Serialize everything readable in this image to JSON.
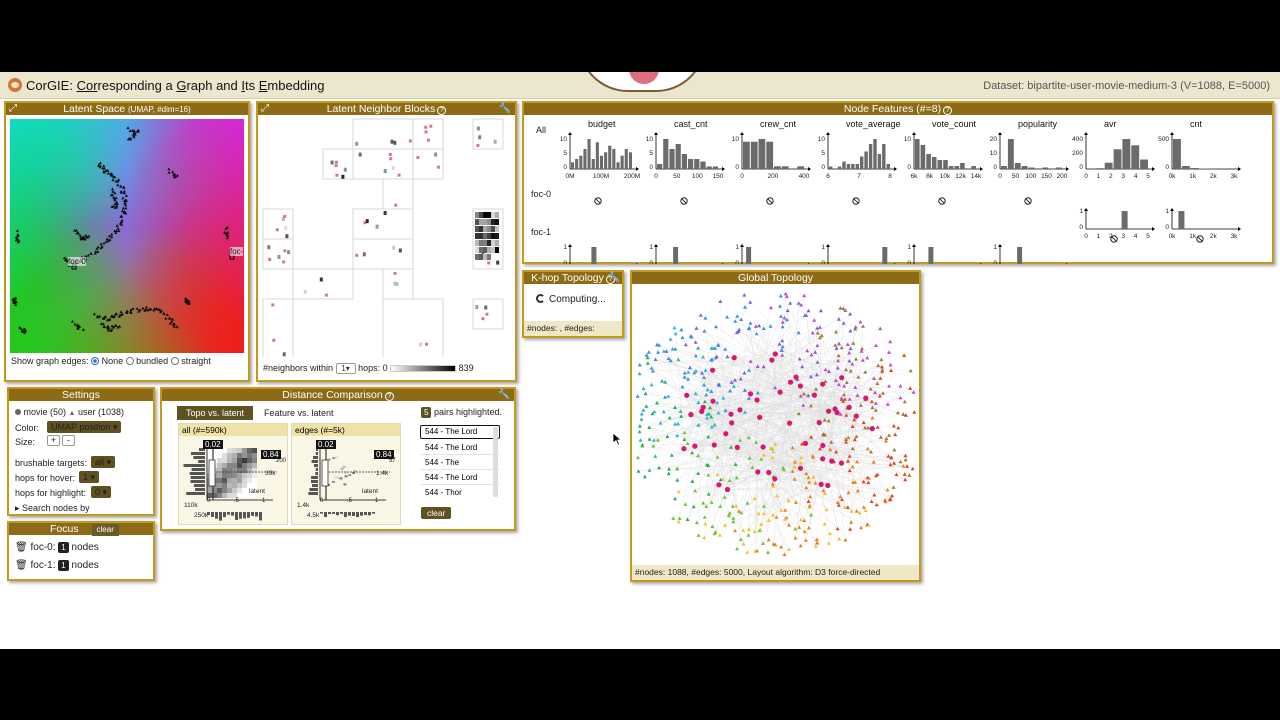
{
  "app": {
    "title_pre": "CorGIE: ",
    "title_c1": "Cor",
    "title_m1": "responding a ",
    "title_c2": "G",
    "title_m2": "raph and ",
    "title_c3": "I",
    "title_m3": "ts ",
    "title_c4": "E",
    "title_m4": "mbedding",
    "dataset": "Dataset: bipartite-user-movie-medium-3 (V=1088, E=5000)"
  },
  "latent": {
    "title": "Latent Space",
    "subtitle": "(UMAP, #dim=16)",
    "label_foc0": "foc-0",
    "label_foc1": "foc-",
    "edges_label": "Show graph edges:",
    "opt_none": "None",
    "opt_bundled": "bundled",
    "opt_straight": "straight"
  },
  "neighbors": {
    "title": "Latent Neighbor Blocks",
    "footer_pre": "#neighbors within",
    "hops_value": "1",
    "footer_hops": "hops:",
    "range_min": "0",
    "range_max": "839"
  },
  "features": {
    "title": "Node Features (#=8)",
    "row_all": "All",
    "row_foc0": "foc-0",
    "row_foc1": "foc-1",
    "columns": [
      {
        "name": "budget",
        "ticks": [
          "0M",
          "100M",
          "200M"
        ],
        "yticks": [
          "10",
          "5",
          "0"
        ]
      },
      {
        "name": "cast_cnt",
        "ticks": [
          "0",
          "50",
          "100",
          "150"
        ],
        "yticks": [
          "10",
          "5",
          "0"
        ]
      },
      {
        "name": "crew_cnt",
        "ticks": [
          "0",
          "200",
          "400"
        ],
        "yticks": [
          "10",
          "0"
        ]
      },
      {
        "name": "vote_average",
        "ticks": [
          "6",
          "7",
          "8"
        ],
        "yticks": [
          "10",
          "5",
          "0"
        ]
      },
      {
        "name": "vote_count",
        "ticks": [
          "6k",
          "8k",
          "10k",
          "12k",
          "14k"
        ],
        "yticks": [
          "10",
          "0"
        ]
      },
      {
        "name": "popularity",
        "ticks": [
          "0",
          "50",
          "100",
          "150",
          "200"
        ],
        "yticks": [
          "20",
          "10",
          "0"
        ]
      },
      {
        "name": "avr",
        "ticks": [
          "0",
          "1",
          "2",
          "3",
          "4",
          "5"
        ],
        "yticks": [
          "400",
          "200",
          "0"
        ]
      },
      {
        "name": "cnt",
        "ticks": [
          "0k",
          "1k",
          "2k",
          "3k"
        ],
        "yticks": [
          "500",
          "0"
        ]
      }
    ]
  },
  "khop": {
    "title": "K-hop Topology",
    "status": "Computing...",
    "footer": "#nodes: , #edges:"
  },
  "global": {
    "title": "Global Topology",
    "footer": "#nodes: 1088, #edges: 5000, Layout algorithm: D3 force-directed"
  },
  "settings": {
    "title": "Settings",
    "legend_movie": "movie (50)",
    "legend_user": "user (1038)",
    "color_label": "Color:",
    "color_value": "UMAP position",
    "size_label": "Size:",
    "size_plus": "+",
    "size_minus": "-",
    "brush_label": "brushable targets:",
    "brush_value": "all",
    "hover_label": "hops for hover:",
    "hover_value": "1",
    "highlight_label": "hops for highlight:",
    "highlight_value": "0",
    "search_label": "Search nodes by"
  },
  "focus": {
    "title": "Focus",
    "clear": "clear",
    "items": [
      {
        "name": "foc-0:",
        "count": "1",
        "unit": "nodes"
      },
      {
        "name": "foc-1:",
        "count": "1",
        "unit": "nodes"
      }
    ]
  },
  "distance": {
    "title": "Distance Comparison",
    "tab_active": "Topo vs. latent",
    "tab_other": "Feature vs. latent",
    "highlight_count": "5",
    "highlight_text": "pairs highlighted.",
    "chart_all": {
      "title": "all (#=590k)",
      "val_left": "0.02",
      "val_right": "0.84",
      "xlabel": "latent",
      "tick_y1": "110k",
      "tick_y2": "250k",
      "tick_r1": "39k",
      "tick_r2": "200",
      "x0": "0",
      "x1": ".5",
      "x2": "1"
    },
    "chart_edges": {
      "title": "edges (#=5k)",
      "val_left": "0.02",
      "val_right": "0.84",
      "xlabel": "latent",
      "tick_y1": "1.4k",
      "tick_y2": "4.5k",
      "tick_r1": "1.4k",
      "tick_r2": "57",
      "x0": "0",
      "x1": ".5",
      "x2": "1"
    },
    "pairs": [
      "544 - The Lord",
      "544 - The Lord",
      "544 - The",
      "544 - The Lord",
      "544 - Thor"
    ],
    "clear": "clear"
  },
  "colors": {
    "accent": "#c19a1f",
    "header": "#8c6a16",
    "footer": "#efe7c6",
    "movie_node": "#d6186e"
  },
  "hist_bars": [
    [
      2,
      3,
      4,
      6,
      9,
      3,
      8,
      4,
      5,
      7,
      6,
      2,
      4,
      6,
      5
    ],
    [
      2,
      12,
      8,
      10,
      6,
      4,
      4,
      3,
      1,
      1
    ],
    [
      10,
      10,
      11,
      10,
      1,
      1,
      0,
      1
    ],
    [
      1,
      0,
      1,
      3,
      2,
      2,
      2,
      5,
      7,
      10,
      12,
      6,
      10,
      2
    ],
    [
      10,
      8,
      5,
      4,
      3,
      3,
      1,
      1,
      2,
      0,
      1
    ],
    [
      2,
      20,
      4,
      2,
      1,
      0,
      1,
      0,
      1
    ],
    [
      1,
      10,
      80,
      250,
      380,
      300,
      120
    ],
    [
      600,
      60,
      20,
      10,
      5,
      2,
      1
    ]
  ],
  "foc0_bars": {
    "avr": [
      0,
      0,
      0,
      1,
      0,
      0
    ],
    "cnt": [
      1,
      0,
      0,
      0
    ]
  },
  "foc1_bars": {
    "budget": [
      0,
      0,
      1,
      0,
      0,
      0,
      0
    ],
    "cast_cnt": [
      0,
      1,
      0,
      0,
      0
    ],
    "crew_cnt": [
      1,
      0,
      0,
      0,
      0,
      0
    ],
    "vote_average": [
      0,
      0,
      0,
      0,
      1
    ],
    "vote_count": [
      0,
      1,
      0,
      0,
      0,
      0
    ],
    "popularity": [
      0,
      1,
      0,
      0,
      0
    ]
  },
  "icons": {
    "expand": "expand-icon",
    "wrench": "wrench-icon",
    "help": "help-icon",
    "no_data": "no-data-icon",
    "trash": "trash-icon",
    "spinner": "spinner-icon"
  }
}
